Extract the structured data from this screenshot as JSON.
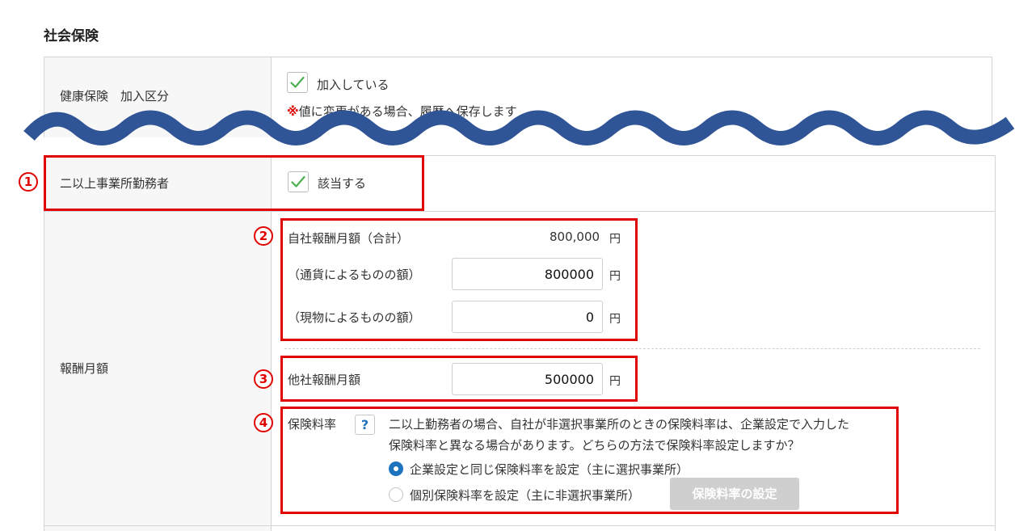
{
  "section_title": "社会保険",
  "health_insurance": {
    "label": "健康保険　加入区分",
    "checkbox_label": "加入している",
    "note_mark": "※",
    "note_text": "値に変更がある場合、履歴へ保存します"
  },
  "multi_office": {
    "label": "二以上事業所勤務者",
    "checkbox_label": "該当する",
    "marker": "1"
  },
  "monthly_remuneration": {
    "label": "報酬月額",
    "own_company": {
      "marker": "2",
      "total_label": "自社報酬月額（合計）",
      "total_value": "800,000",
      "currency_label": "（通貨によるものの額）",
      "currency_value": "800000",
      "kind_label": "（現物によるものの額）",
      "kind_value": "0"
    },
    "other_company": {
      "marker": "3",
      "label": "他社報酬月額",
      "value": "500000"
    },
    "unit": "円"
  },
  "insurance_rate": {
    "marker": "4",
    "label": "保険料率",
    "help_icon": "?",
    "description_line1": "二以上勤務者の場合、自社が非選択事業所のときの保険料率は、企業設定で入力した",
    "description_line2": "保険料率と異なる場合があります。どちらの方法で保険料率設定しますか？",
    "option_same": "企業設定と同じ保険料率を設定（主に選択事業所）",
    "option_individual": "個別保険料率を設定（主に非選択事業所）",
    "settings_button": "保険料率の設定",
    "selected": "option_same"
  },
  "colors": {
    "accent": "#1e73be",
    "highlight": "#e00000",
    "wave": "#2f5597",
    "check": "#4caf50"
  }
}
